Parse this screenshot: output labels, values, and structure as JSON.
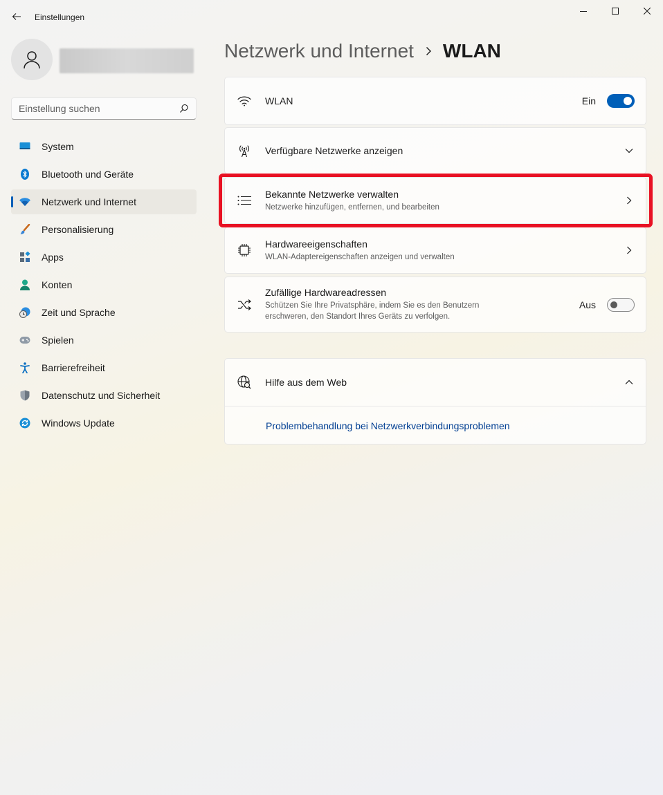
{
  "app": {
    "title": "Einstellungen"
  },
  "search": {
    "placeholder": "Einstellung suchen"
  },
  "sidebar": {
    "items": [
      {
        "label": "System",
        "icon": "monitor-icon"
      },
      {
        "label": "Bluetooth und Geräte",
        "icon": "bluetooth-icon"
      },
      {
        "label": "Netzwerk und Internet",
        "icon": "wifi-icon",
        "active": true
      },
      {
        "label": "Personalisierung",
        "icon": "brush-icon"
      },
      {
        "label": "Apps",
        "icon": "apps-icon"
      },
      {
        "label": "Konten",
        "icon": "person-icon"
      },
      {
        "label": "Zeit und Sprache",
        "icon": "clock-globe-icon"
      },
      {
        "label": "Spielen",
        "icon": "gamepad-icon"
      },
      {
        "label": "Barrierefreiheit",
        "icon": "accessibility-icon"
      },
      {
        "label": "Datenschutz und Sicherheit",
        "icon": "shield-icon"
      },
      {
        "label": "Windows Update",
        "icon": "update-icon"
      }
    ]
  },
  "breadcrumb": {
    "parent": "Netzwerk und Internet",
    "current": "WLAN"
  },
  "settings": {
    "wlan": {
      "title": "WLAN",
      "toggle_label": "Ein",
      "toggle_on": true
    },
    "available": {
      "title": "Verfügbare Netzwerke anzeigen"
    },
    "known": {
      "title": "Bekannte Netzwerke verwalten",
      "subtitle": "Netzwerke hinzufügen, entfernen, und bearbeiten"
    },
    "hardware": {
      "title": "Hardwareeigenschaften",
      "subtitle": "WLAN-Adaptereigenschaften anzeigen und verwalten"
    },
    "random": {
      "title": "Zufällige Hardwareadressen",
      "subtitle_line1": "Schützen Sie Ihre Privatsphäre, indem Sie es den Benutzern",
      "subtitle_line2": "erschweren, den Standort Ihres Geräts zu verfolgen.",
      "toggle_label": "Aus",
      "toggle_on": false
    }
  },
  "help": {
    "title": "Hilfe aus dem Web",
    "link": "Problembehandlung bei Netzwerkverbindungsproblemen"
  },
  "colors": {
    "accent": "#005fb8",
    "highlight": "#e81123",
    "link": "#003e92"
  }
}
